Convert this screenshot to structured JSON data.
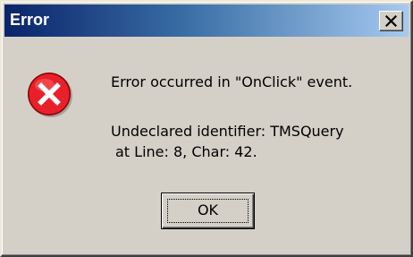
{
  "window": {
    "title": "Error",
    "close_icon": "close-icon"
  },
  "message": {
    "icon": "error-icon",
    "line1": "Error occurred in \"OnClick\" event.",
    "line2": "Undeclared identifier: TMSQuery",
    "line3": "at Line: 8, Char: 42."
  },
  "buttons": {
    "ok_label": "OK"
  },
  "colors": {
    "title_bar_start": "#0a246a",
    "title_bar_end": "#a6caf0",
    "dialog_face": "#d4d0c8",
    "error_red": "#e8202a"
  }
}
